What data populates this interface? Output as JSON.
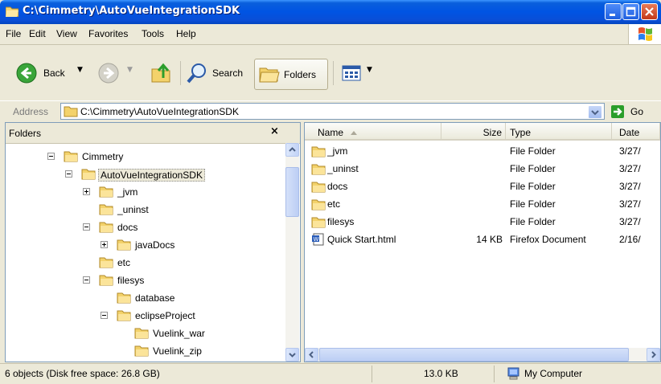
{
  "window": {
    "title": "C:\\Cimmetry\\AutoVueIntegrationSDK"
  },
  "menu": [
    "File",
    "Edit",
    "View",
    "Favorites",
    "Tools",
    "Help"
  ],
  "toolbar": {
    "back": "Back",
    "search": "Search",
    "folders": "Folders"
  },
  "address": {
    "label": "Address",
    "path": "C:\\Cimmetry\\AutoVueIntegrationSDK",
    "go": "Go"
  },
  "folders_pane": {
    "title": "Folders",
    "tree": [
      {
        "label": "Cimmetry",
        "expander": "minus"
      },
      {
        "label": "AutoVueIntegrationSDK",
        "expander": "minus",
        "selected": true
      },
      {
        "label": "_jvm",
        "expander": "plus"
      },
      {
        "label": "_uninst",
        "expander": "none"
      },
      {
        "label": "docs",
        "expander": "minus"
      },
      {
        "label": "javaDocs",
        "expander": "plus"
      },
      {
        "label": "etc",
        "expander": "none"
      },
      {
        "label": "filesys",
        "expander": "minus"
      },
      {
        "label": "database",
        "expander": "none"
      },
      {
        "label": "eclipseProject",
        "expander": "minus"
      },
      {
        "label": "Vuelink_war",
        "expander": "none"
      },
      {
        "label": "Vuelink_zip",
        "expander": "none"
      }
    ]
  },
  "file_list": {
    "columns": [
      "Name",
      "Size",
      "Type",
      "Date"
    ],
    "rows": [
      {
        "name": "_jvm",
        "size": "",
        "type": "File Folder",
        "date": "3/27/",
        "icon": "folder-icon"
      },
      {
        "name": "_uninst",
        "size": "",
        "type": "File Folder",
        "date": "3/27/",
        "icon": "folder-icon"
      },
      {
        "name": "docs",
        "size": "",
        "type": "File Folder",
        "date": "3/27/",
        "icon": "folder-icon"
      },
      {
        "name": "etc",
        "size": "",
        "type": "File Folder",
        "date": "3/27/",
        "icon": "folder-icon"
      },
      {
        "name": "filesys",
        "size": "",
        "type": "File Folder",
        "date": "3/27/",
        "icon": "folder-icon"
      },
      {
        "name": "Quick Start.html",
        "size": "14 KB",
        "type": "Firefox Document",
        "date": "2/16/",
        "icon": "html-document-icon"
      }
    ]
  },
  "status": {
    "objects": "6 objects (Disk free space: 26.8 GB)",
    "size": "13.0 KB",
    "location": "My Computer"
  },
  "colors": {
    "titlebar": "#0054e3",
    "chrome": "#ece9d8",
    "folder": "#f3d26b",
    "selection": "#316ac5"
  }
}
